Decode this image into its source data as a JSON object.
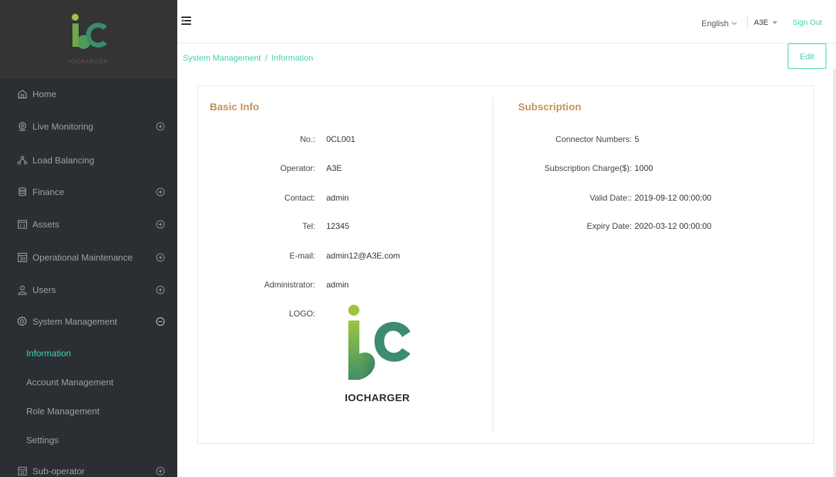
{
  "brand": {
    "logo_caption": "IOCHARGER"
  },
  "header": {
    "language": "English",
    "user": "A3E",
    "sign_out": "Sign Out"
  },
  "sidebar": {
    "items": [
      {
        "label": "Home",
        "icon": "home-icon",
        "expandable": false
      },
      {
        "label": "Live Monitoring",
        "icon": "monitor-icon",
        "expandable": true
      },
      {
        "label": "Load Balancing",
        "icon": "network-icon",
        "expandable": false
      },
      {
        "label": "Finance",
        "icon": "database-icon",
        "expandable": true
      },
      {
        "label": "Assets",
        "icon": "code-window-icon",
        "expandable": true
      },
      {
        "label": "Operational Maintenance",
        "icon": "maintenance-icon",
        "expandable": true
      },
      {
        "label": "Users",
        "icon": "user-icon",
        "expandable": true
      },
      {
        "label": "System Management",
        "icon": "gear-icon",
        "expandable": true,
        "expanded": true
      },
      {
        "label": "Sub-operator",
        "icon": "sub-operator-icon",
        "expandable": true
      }
    ],
    "system_management_children": [
      {
        "label": "Information",
        "active": true
      },
      {
        "label": "Account Management",
        "active": false
      },
      {
        "label": "Role Management",
        "active": false
      },
      {
        "label": "Settings",
        "active": false
      }
    ]
  },
  "breadcrumb": {
    "parent": "System Management",
    "separator": "/",
    "current": "Information"
  },
  "toolbar": {
    "edit_label": "Edit"
  },
  "basic_info": {
    "title": "Basic Info",
    "fields": [
      {
        "label": "No.:",
        "value": "0CL001"
      },
      {
        "label": "Operator:",
        "value": "A3E"
      },
      {
        "label": "Contact:",
        "value": "admin"
      },
      {
        "label": "Tel:",
        "value": "12345"
      },
      {
        "label": "E-mail:",
        "value": "admin12@A3E.com"
      },
      {
        "label": "Administrator:",
        "value": "admin"
      }
    ],
    "logo_label": "LOGO:",
    "logo_caption": "IOCHARGER"
  },
  "subscription": {
    "title": "Subscription",
    "fields": [
      {
        "label": "Connector Numbers:",
        "value": "5"
      },
      {
        "label": "Subscription Charge($):",
        "value": "1000"
      },
      {
        "label": "Valid Date::",
        "value": "2019-09-12 00:00:00"
      },
      {
        "label": "Expiry Date:",
        "value": "2020-03-12 00:00:00"
      }
    ]
  },
  "colors": {
    "accent": "#3fd0b0",
    "section_title": "#c9925a",
    "sidebar_bg": "#2b2f33"
  }
}
